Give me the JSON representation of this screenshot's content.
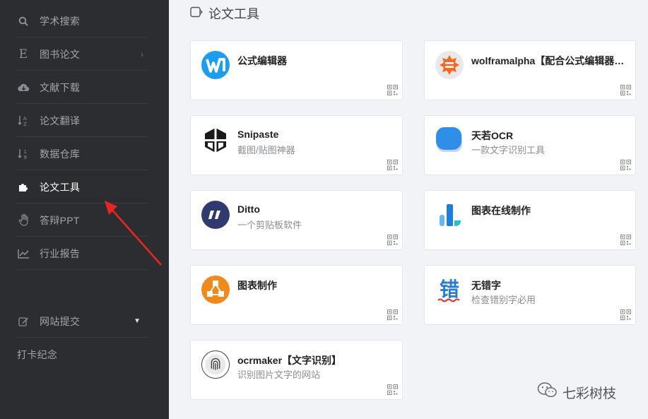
{
  "sidebar": {
    "items": [
      {
        "label": "学术搜索",
        "icon": "search-icon"
      },
      {
        "label": "图书论文",
        "icon": "letter-e-icon"
      },
      {
        "label": "文献下载",
        "icon": "cloud-download-icon"
      },
      {
        "label": "论文翻译",
        "icon": "sort-az-icon"
      },
      {
        "label": "数据仓库",
        "icon": "sort-numeric-icon"
      },
      {
        "label": "论文工具",
        "icon": "puzzle-icon"
      },
      {
        "label": "答辩PPT",
        "icon": "hand-icon"
      },
      {
        "label": "行业报告",
        "icon": "line-chart-icon"
      }
    ],
    "submit": {
      "label": "网站提交",
      "icon": "edit-icon"
    },
    "checkin": {
      "label": "打卡纪念"
    }
  },
  "main": {
    "title": "论文工具",
    "cards": [
      {
        "title": "公式编辑器",
        "desc": "",
        "logo": "mathtype-logo",
        "color": "#1e9df0"
      },
      {
        "title": "wolframalpha【配合公式编辑器…",
        "desc": "",
        "logo": "wolframalpha-logo",
        "color": "#f16a25"
      },
      {
        "title": "Snipaste",
        "desc": "截图/贴图神器",
        "logo": "snipaste-logo",
        "color": "#1a1a1a"
      },
      {
        "title": "天若OCR",
        "desc": "一款文字识别工具",
        "logo": "tianruo-ocr-logo",
        "color": "#2f8fe8"
      },
      {
        "title": "Ditto",
        "desc": "一个剪贴板软件",
        "logo": "ditto-logo",
        "color": "#2f3a6e"
      },
      {
        "title": "图表在线制作",
        "desc": "",
        "logo": "chart-online-logo",
        "color": "#1f7fd8"
      },
      {
        "title": "图表制作",
        "desc": "",
        "logo": "chart-maker-logo",
        "color": "#f08a1c"
      },
      {
        "title": "无错字",
        "desc": "检查错别字必用",
        "logo": "wucuozi-logo",
        "color": "#2a7bd6"
      },
      {
        "title": "ocrmaker【文字识别】",
        "desc": "识别图片文字的网站",
        "logo": "ocrmaker-logo",
        "color": "#333333"
      }
    ]
  },
  "watermark": {
    "text": "七彩树枝",
    "icon": "wechat-icon"
  }
}
